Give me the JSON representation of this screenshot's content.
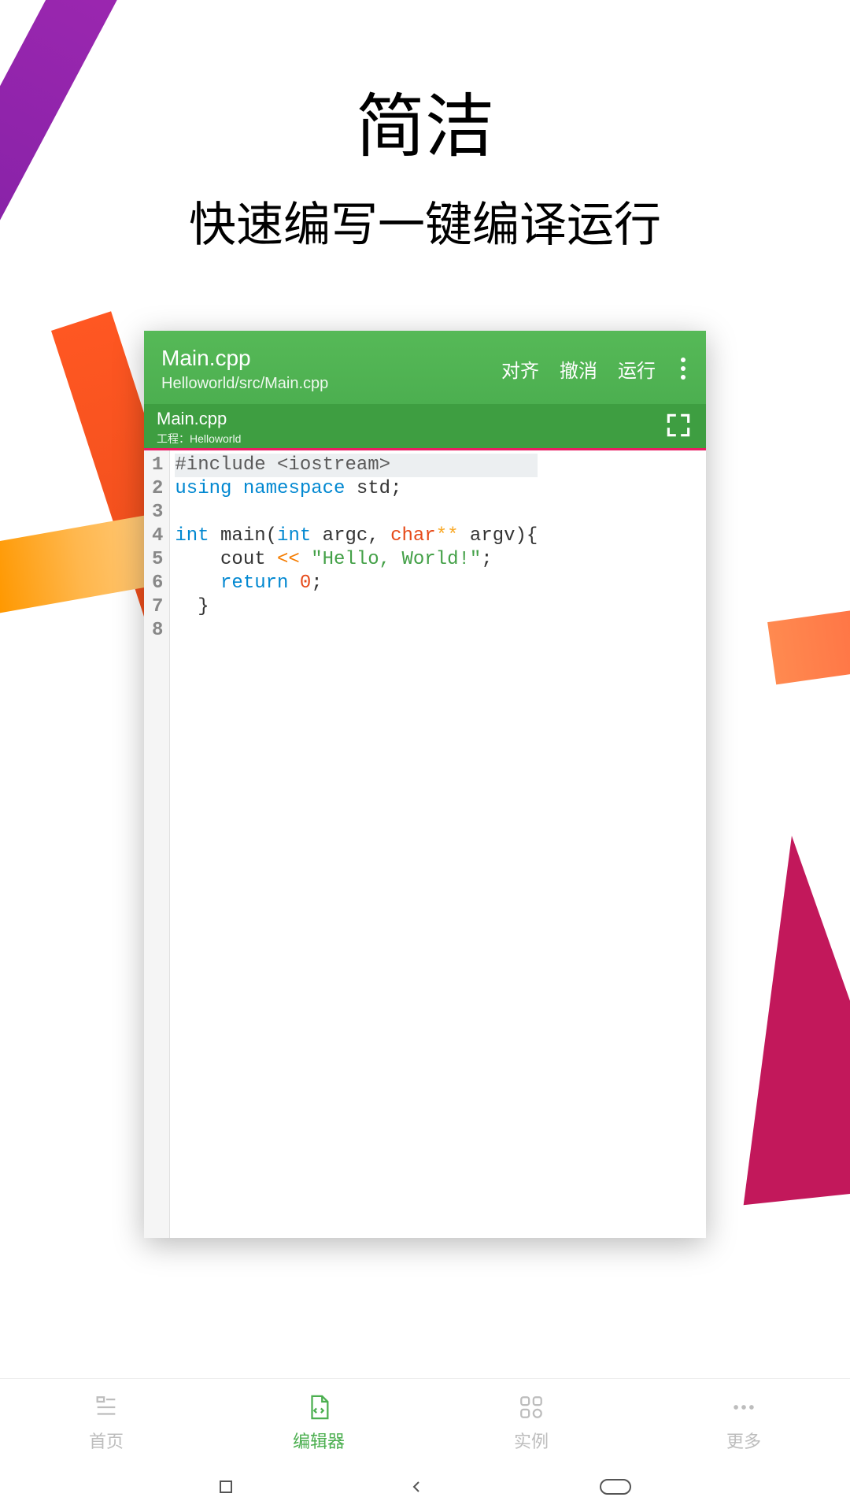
{
  "headline": {
    "title": "简洁",
    "subtitle": "快速编写一键编译运行"
  },
  "editor": {
    "filename": "Main.cpp",
    "path": "Helloworld/src/Main.cpp",
    "actions": {
      "align": "对齐",
      "undo": "撤消",
      "run": "运行"
    },
    "tab": {
      "name": "Main.cpp",
      "project": "工程：Helloworld"
    },
    "code": {
      "lines": [
        "1",
        "2",
        "3",
        "4",
        "5",
        "6",
        "7",
        "8"
      ],
      "l1_pre": "#include <iostream>",
      "l2_kw1": "using",
      "l2_kw2": "namespace",
      "l2_id": "std",
      "l2_end": ";",
      "l4_kw1": "int",
      "l4_id1": " main(",
      "l4_kw2": "int",
      "l4_id2": " argc, ",
      "l4_kw3": "char",
      "l4_star": "**",
      "l4_id3": " argv){",
      "l5_indent": "    ",
      "l5_id": "cout ",
      "l5_op": "<<",
      "l5_sp": " ",
      "l5_str": "\"Hello, World!\"",
      "l5_end": ";",
      "l6_indent": "    ",
      "l6_kw": "return",
      "l6_sp": " ",
      "l6_num": "0",
      "l6_end": ";",
      "l7": "  }"
    }
  },
  "bottom_nav": {
    "home": "首页",
    "editor": "编辑器",
    "examples": "实例",
    "more": "更多"
  }
}
